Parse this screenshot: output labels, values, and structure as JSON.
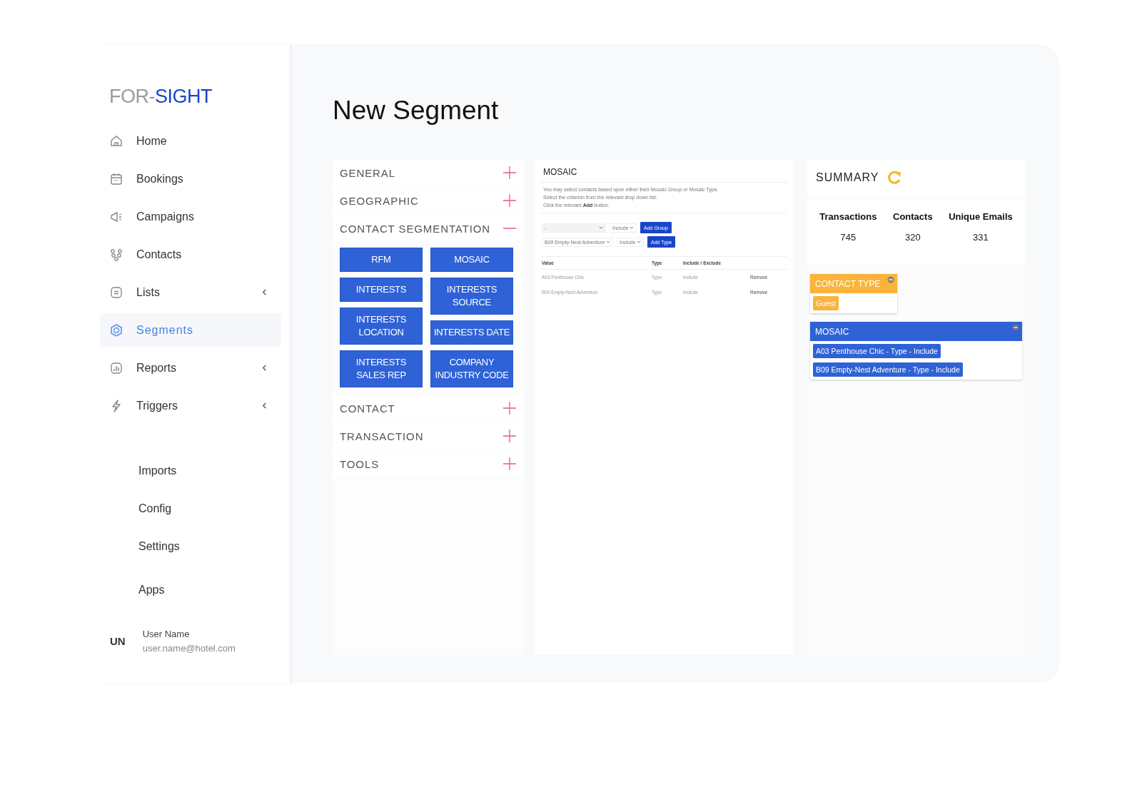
{
  "sidebar": {
    "logo": {
      "prefix": "FOR-",
      "name": "SIGHT"
    },
    "items": [
      {
        "label": "Home",
        "selected": false,
        "has_submenu": false
      },
      {
        "label": "Bookings",
        "selected": false,
        "has_submenu": false
      },
      {
        "label": "Campaigns",
        "selected": false,
        "has_submenu": false
      },
      {
        "label": "Contacts",
        "selected": false,
        "has_submenu": false
      },
      {
        "label": "Lists",
        "selected": false,
        "has_submenu": true
      },
      {
        "label": "Segments",
        "selected": true,
        "has_submenu": false
      },
      {
        "label": "Reports",
        "selected": false,
        "has_submenu": true
      },
      {
        "label": "Triggers",
        "selected": false,
        "has_submenu": true
      }
    ],
    "secondary_items": [
      "Imports",
      "Config",
      "Settings",
      "Apps"
    ],
    "user": {
      "initials": "UN",
      "name": "User Name",
      "email": "user.name@hotel.com"
    }
  },
  "page_title": "New Segment",
  "sections": [
    {
      "label": "GENERAL",
      "expanded": false
    },
    {
      "label": "GEOGRAPHIC",
      "expanded": false
    },
    {
      "label": "CONTACT SEGMENTATION",
      "expanded": true,
      "buttons": [
        "RFM",
        "MOSAIC",
        "INTERESTS",
        "INTERESTS SOURCE",
        "INTERESTS LOCATION",
        "INTERESTS DATE",
        "INTERESTS SALES REP",
        "COMPANY INDUSTRY CODE"
      ]
    },
    {
      "label": "CONTACT",
      "expanded": false
    },
    {
      "label": "TRANSACTION",
      "expanded": false
    },
    {
      "label": "TOOLS",
      "expanded": false
    }
  ],
  "mosaic": {
    "title": "MOSAIC",
    "instructions": [
      "You may select contacts based upon either their Mosaic Group or Mosaic Type.",
      "Select the criterion from the relevant drop down list.",
      "Click the relevant **Add** button."
    ],
    "pickers": [
      {
        "value": "-",
        "mode": "Include",
        "button": "Add Group"
      },
      {
        "value": "B09 Empty-Nest Adventure",
        "mode": "Include",
        "button": "Add Type"
      }
    ],
    "table": {
      "columns": [
        "Value",
        "Type",
        "Include / Exclude"
      ],
      "rows": [
        {
          "value": "A03 Penthouse Chic",
          "type": "Type",
          "mode": "Include",
          "action": "Remove"
        },
        {
          "value": "B09 Empty-Nest Adventure",
          "type": "Type",
          "mode": "Include",
          "action": "Remove"
        }
      ]
    }
  },
  "summary": {
    "title": "SUMMARY",
    "stats": [
      {
        "label": "Transactions",
        "value": "745"
      },
      {
        "label": "Contacts",
        "value": "320"
      },
      {
        "label": "Unique Emails",
        "value": "331"
      }
    ],
    "filters": [
      {
        "label": "CONTACT TYPE",
        "color": "#fbb33b",
        "tags": [
          "Guest"
        ]
      },
      {
        "label": "MOSAIC",
        "color": "#2f62d6",
        "tags": [
          "A03 Penthouse Chic - Type - Include",
          "B09 Empty-Nest Adventure - Type - Include"
        ]
      }
    ]
  }
}
